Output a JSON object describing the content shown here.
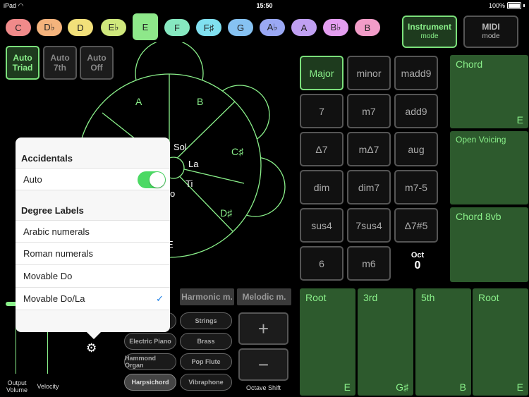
{
  "status_bar": {
    "device": "iPad",
    "time": "15:50",
    "battery": "100%"
  },
  "keys": [
    {
      "label": "C",
      "color": "#f08a8a"
    },
    {
      "label": "D♭",
      "color": "#f4b37c"
    },
    {
      "label": "D",
      "color": "#f2e07a"
    },
    {
      "label": "E♭",
      "color": "#cfe87c"
    },
    {
      "label": "E",
      "color": "#8ee88a",
      "selected": true
    },
    {
      "label": "F",
      "color": "#86e8c0"
    },
    {
      "label": "F♯",
      "color": "#80e0f0"
    },
    {
      "label": "G",
      "color": "#86c2f2"
    },
    {
      "label": "A♭",
      "color": "#9aa8f4"
    },
    {
      "label": "A",
      "color": "#c0a0f2"
    },
    {
      "label": "B♭",
      "color": "#e49ef0"
    },
    {
      "label": "B",
      "color": "#f29cc8"
    }
  ],
  "modes": {
    "instrument": {
      "label": "Instrument",
      "sub": "mode"
    },
    "midi": {
      "label": "MIDI",
      "sub": "mode"
    }
  },
  "auto_buttons": [
    {
      "line1": "Auto",
      "line2": "Triad"
    },
    {
      "line1": "Auto",
      "line2": "7th"
    },
    {
      "line1": "Auto",
      "line2": "Off"
    }
  ],
  "wheel": {
    "note_labels": [
      "A",
      "B",
      "C♯",
      "D♯"
    ],
    "degree_labels": [
      "Sol",
      "La",
      "Ti",
      "o",
      "E"
    ]
  },
  "popover": {
    "accidentals_header": "Accidentals",
    "auto_label": "Auto",
    "auto_on": true,
    "degree_header": "Degree Labels",
    "options": [
      "Arabic numerals",
      "Roman numerals",
      "Movable Do",
      "Movable Do/La"
    ],
    "selected_option": "Movable Do/La"
  },
  "chord_qualities": [
    [
      "Major",
      "minor",
      "madd9"
    ],
    [
      "7",
      "m7",
      "add9"
    ],
    [
      "Δ7",
      "mΔ7",
      "aug"
    ],
    [
      "dim",
      "dim7",
      "m7-5"
    ],
    [
      "sus4",
      "7sus4",
      "Δ7#5"
    ],
    [
      "6",
      "m6"
    ]
  ],
  "octave": {
    "label": "Oct",
    "value": "0"
  },
  "side_pads": [
    {
      "title": "Chord",
      "note": "E"
    },
    {
      "title": "Open Voicing",
      "note": ""
    },
    {
      "title": "Chord 8vb",
      "note": ""
    }
  ],
  "note_pads": [
    {
      "title": "Root",
      "note": "E"
    },
    {
      "title": "3rd",
      "note": "G♯"
    },
    {
      "title": "5th",
      "note": "B"
    },
    {
      "title": "Root",
      "note": "E"
    }
  ],
  "scales": [
    "Harmonic m.",
    "Melodic m."
  ],
  "instruments": [
    [
      "",
      "Strings"
    ],
    [
      "Electric Piano",
      "Brass"
    ],
    [
      "Hammond Organ",
      "Pop Flute"
    ],
    [
      "Harpsichord",
      "Vibraphone"
    ]
  ],
  "selected_instrument": "Harpsichord",
  "octave_shift": {
    "plus": "+",
    "minus": "−",
    "label": "Octave Shift"
  },
  "sliders": {
    "output_volume": "Output\nVolume",
    "velocity": "Velocity"
  }
}
